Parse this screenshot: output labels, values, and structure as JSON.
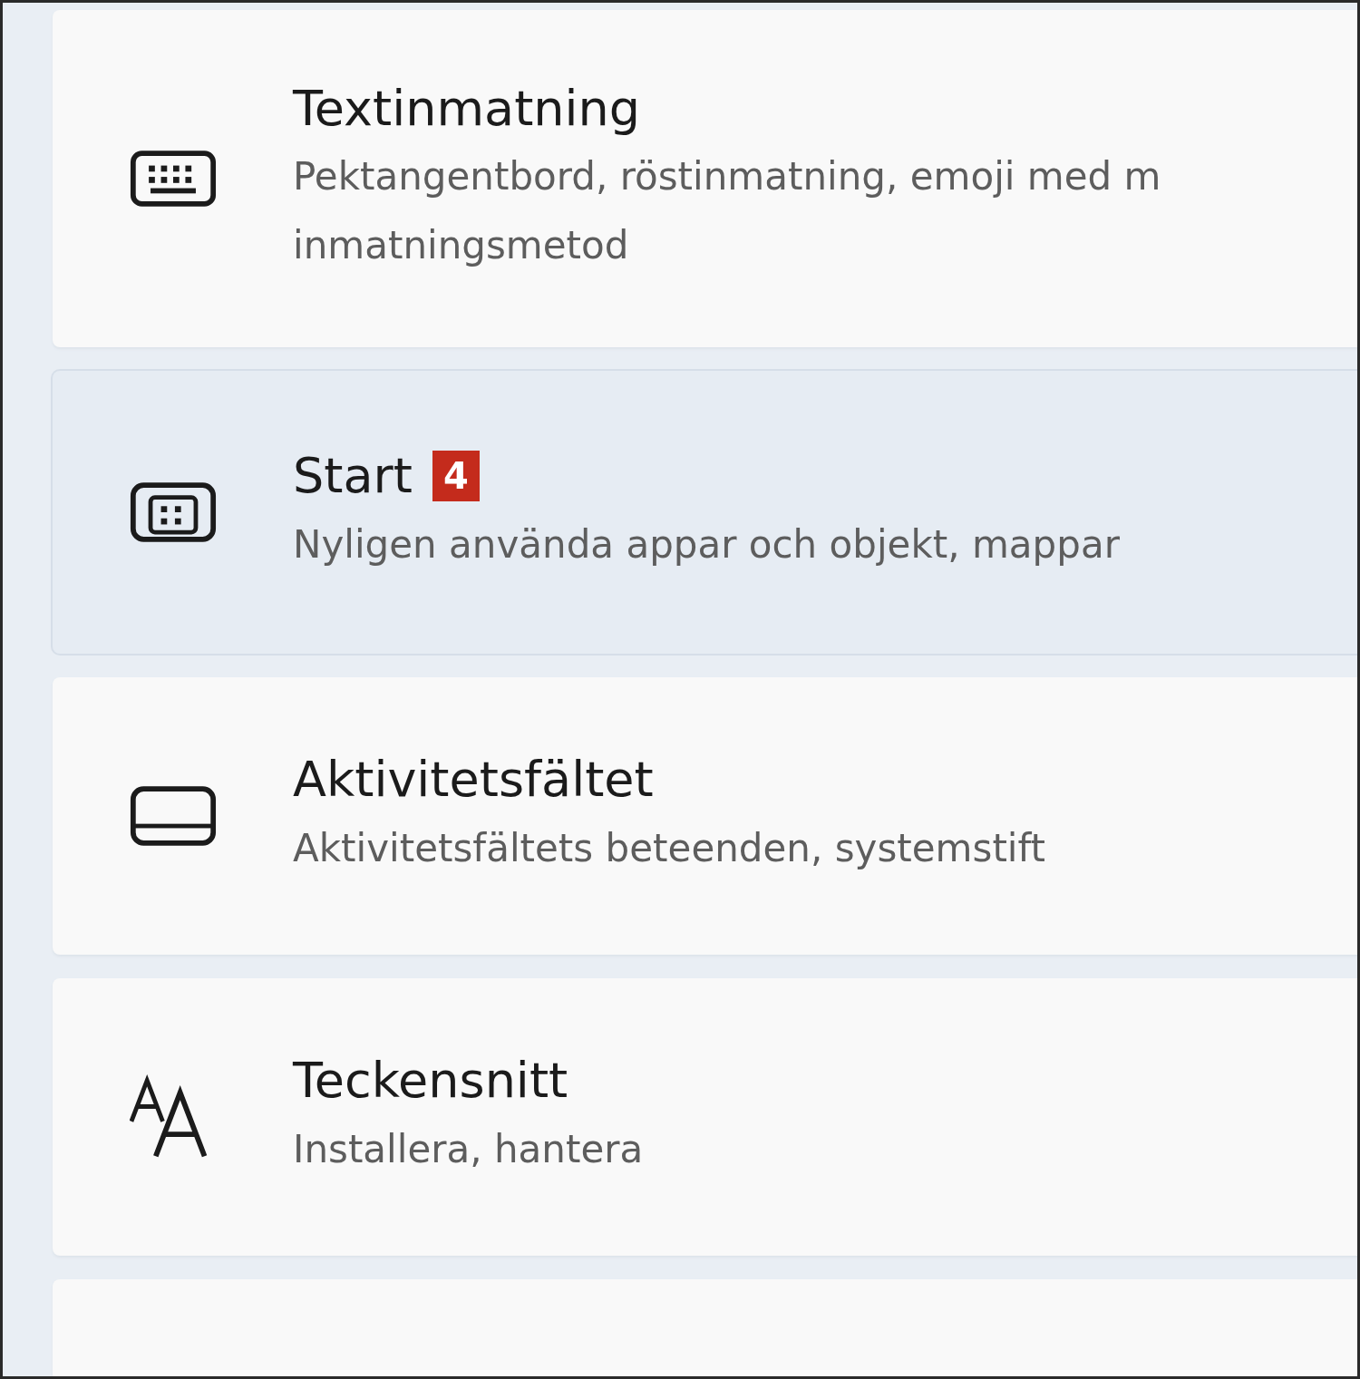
{
  "settings_items": [
    {
      "title": "Textinmatning",
      "description": "Pektangentbord, röstinmatning, emoji med m\ninmatningsmetod",
      "selected": false
    },
    {
      "title": "Start",
      "badge": "4",
      "description": "Nyligen använda appar och objekt, mappar",
      "selected": true
    },
    {
      "title": "Aktivitetsfältet",
      "description": "Aktivitetsfältets beteenden, systemstift",
      "selected": false
    },
    {
      "title": "Teckensnitt",
      "description": "Installera, hantera",
      "selected": false
    },
    {
      "selected": false
    }
  ]
}
